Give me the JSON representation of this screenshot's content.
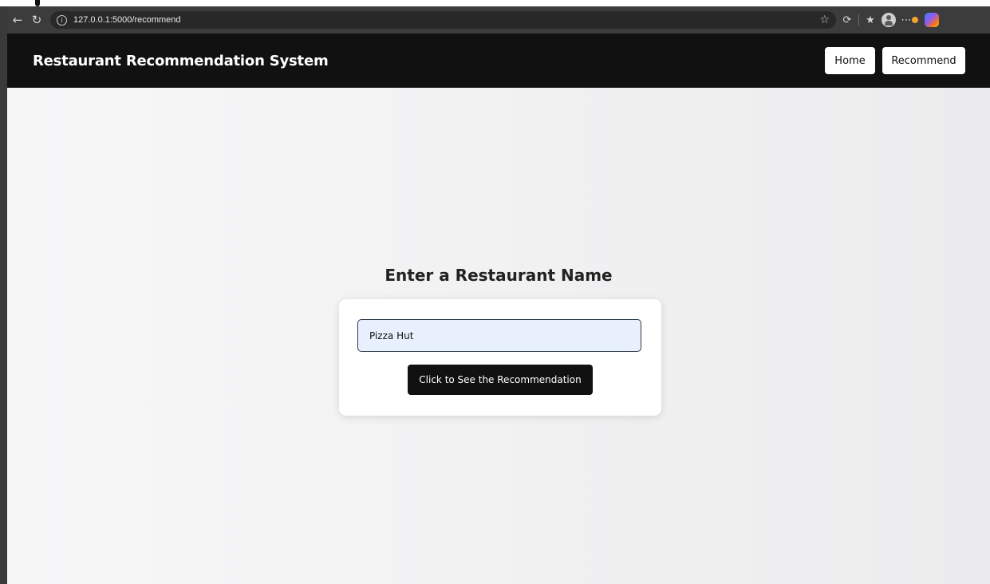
{
  "browser": {
    "url": "127.0.0.1:5000/recommend",
    "icons": {
      "back": "arrow-left-icon",
      "reload": "reload-icon",
      "info": "info-icon",
      "star": "star-icon",
      "extensions": "puzzle-icon",
      "favorites": "favorites-icon",
      "profile": "profile-icon",
      "more": "more-icon",
      "copilot": "copilot-icon"
    }
  },
  "navbar": {
    "brand": "Restaurant Recommendation System",
    "links": [
      {
        "label": "Home"
      },
      {
        "label": "Recommend"
      }
    ]
  },
  "main": {
    "heading": "Enter a Restaurant Name",
    "input_value": "Pizza Hut",
    "submit_label": "Click to See the Recommendation"
  },
  "colors": {
    "navbar_bg": "#111111",
    "button_bg": "#111111",
    "input_bg": "#e9f0fd",
    "page_bg": "#f1f1f2"
  }
}
